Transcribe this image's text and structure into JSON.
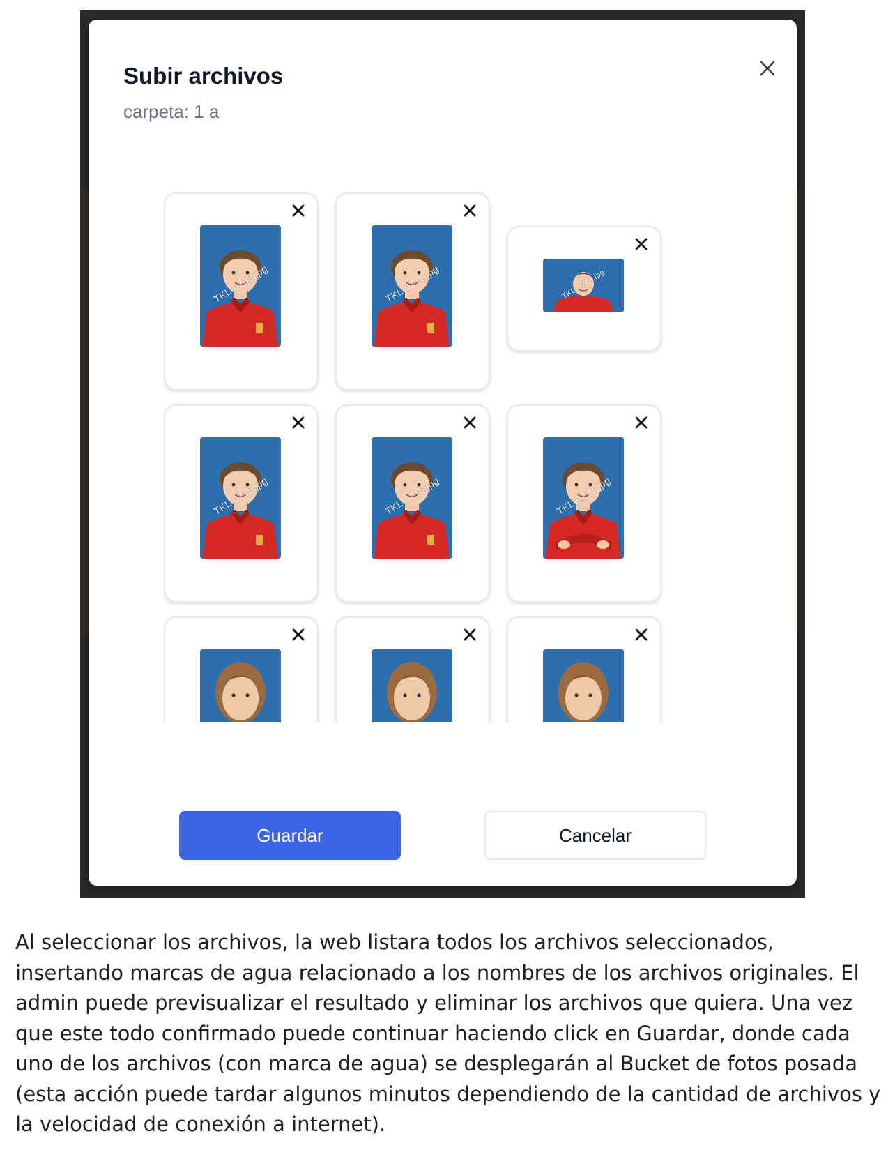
{
  "modal": {
    "title": "Subir archivos",
    "subtitle": "carpeta: 1 a",
    "close_icon": "close-icon"
  },
  "thumbnails": [
    {
      "watermark": "TKL-0208.jpg",
      "subject": "boy",
      "orientation": "portrait"
    },
    {
      "watermark": "TKL-0211.jpg",
      "subject": "boy",
      "orientation": "portrait"
    },
    {
      "watermark": "TKL-0214.jpg",
      "subject": "boy",
      "orientation": "landscape"
    },
    {
      "watermark": "TKL-0215.jpg",
      "subject": "boy",
      "orientation": "portrait"
    },
    {
      "watermark": "TKL-0216.jpg",
      "subject": "boy",
      "orientation": "portrait"
    },
    {
      "watermark": "TKL-0221.jpg",
      "subject": "boy-arms-crossed",
      "orientation": "portrait"
    },
    {
      "watermark": "",
      "subject": "girl",
      "orientation": "portrait"
    },
    {
      "watermark": "",
      "subject": "girl",
      "orientation": "portrait"
    },
    {
      "watermark": "",
      "subject": "girl",
      "orientation": "portrait"
    }
  ],
  "buttons": {
    "save_label": "Guardar",
    "cancel_label": "Cancelar"
  },
  "colors": {
    "primary": "#3b64e3",
    "photo_background": "#2d6fae",
    "shirt": "#d42a23"
  },
  "caption": "Al seleccionar los archivos, la web listara todos los archivos seleccionados, insertando marcas de agua relacionado a los nombres de los archivos originales. El admin puede previsualizar el resultado y eliminar los archivos que quiera. Una vez que este todo confirmado puede continuar haciendo click en Guardar, donde cada uno de los archivos (con marca de agua) se desplegarán al Bucket de fotos posada (esta acción puede tardar algunos minutos dependiendo de la cantidad de archivos y la velocidad de conexión a internet)."
}
